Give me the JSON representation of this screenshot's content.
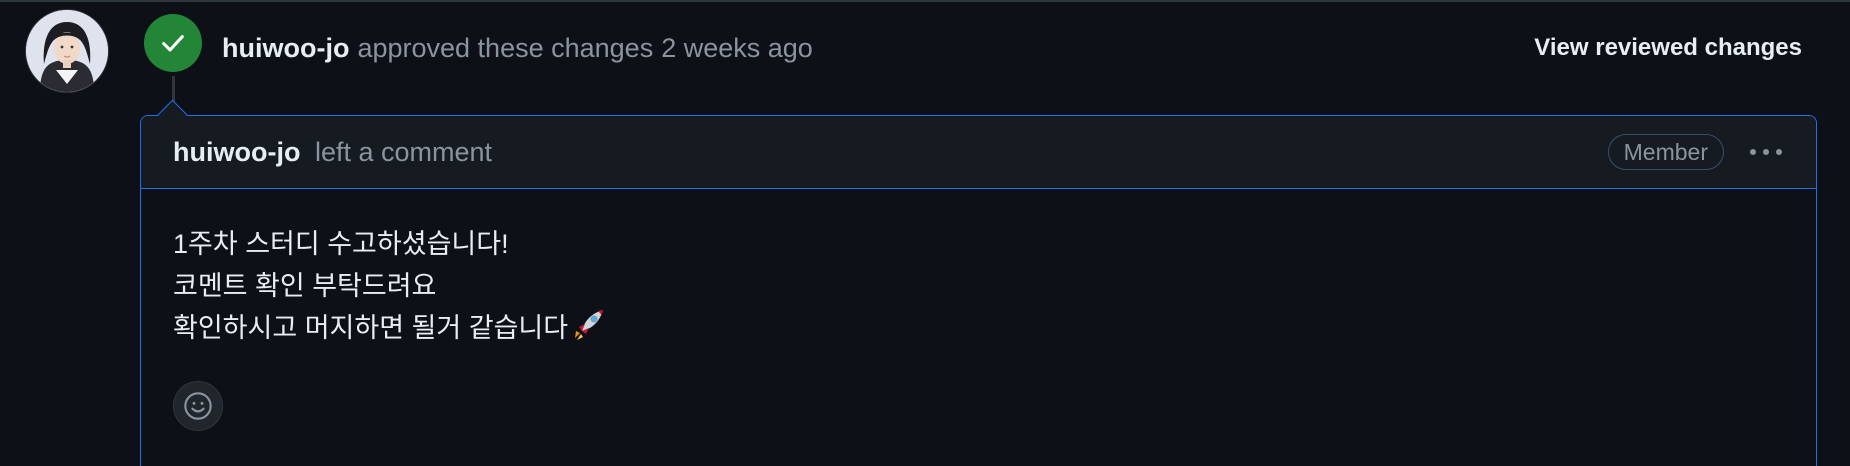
{
  "review": {
    "author": "huiwoo-jo",
    "action_text": "approved these changes",
    "time": "2 weeks ago",
    "view_link": "View reviewed changes",
    "status_color": "#238636"
  },
  "comment": {
    "author": "huiwoo-jo",
    "action_text": "left a comment",
    "role_badge": "Member",
    "lines": [
      "1주차 스터디 수고하셨습니다!",
      "코멘트 확인 부탁드려요",
      "확인하시고 머지하면 될거 같습니다"
    ],
    "trailing_emoji": "rocket-icon"
  },
  "icons": {
    "status": "check-icon",
    "menu": "kebab-horizontal-icon",
    "reaction": "smiley-icon"
  },
  "colors": {
    "background": "#0d1117",
    "header_bg": "#161b22",
    "accent_border": "#1f6feb",
    "muted_text": "#8b949e"
  }
}
